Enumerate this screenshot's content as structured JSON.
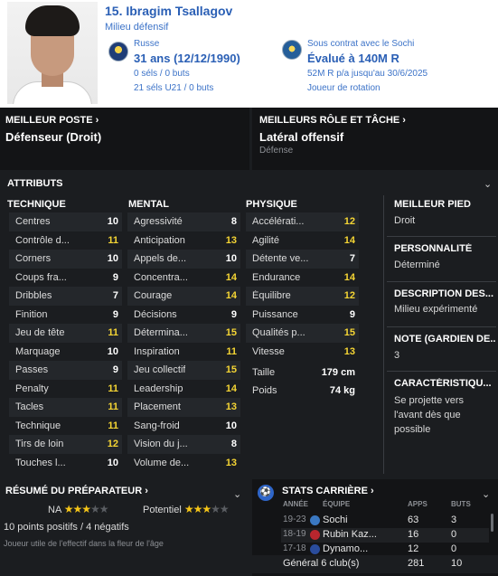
{
  "header": {
    "name": "15. Ibragim Tsallagov",
    "position": "Milieu défensif",
    "nationality": "Russe",
    "age": "31 ans (12/12/1990)",
    "caps": "0 séls / 0 buts",
    "u21_caps": "21 séls U21 / 0 buts",
    "contract": "Sous contrat avec le Sochi",
    "valuation": "Évalué à 140M R",
    "wage": "52M R p/a jusqu'au 30/6/2025",
    "squad_status": "Joueur de rotation"
  },
  "best_position": {
    "title": "MEILLEUR POSTE",
    "value": "Défenseur (Droit)"
  },
  "best_role": {
    "title": "MEILLEURS RÔLE ET TÂCHE",
    "value": "Latéral offensif",
    "duty": "Défense"
  },
  "attributes": {
    "title": "ATTRIBUTS",
    "technical": {
      "title": "TECHNIQUE",
      "rows": [
        {
          "label": "Centres",
          "value": "10"
        },
        {
          "label": "Contrôle d...",
          "value": "11"
        },
        {
          "label": "Corners",
          "value": "10"
        },
        {
          "label": "Coups fra...",
          "value": "9"
        },
        {
          "label": "Dribbles",
          "value": "7"
        },
        {
          "label": "Finition",
          "value": "9"
        },
        {
          "label": "Jeu de tête",
          "value": "11"
        },
        {
          "label": "Marquage",
          "value": "10"
        },
        {
          "label": "Passes",
          "value": "9"
        },
        {
          "label": "Penalty",
          "value": "11"
        },
        {
          "label": "Tacles",
          "value": "11"
        },
        {
          "label": "Technique",
          "value": "11"
        },
        {
          "label": "Tirs de loin",
          "value": "12"
        },
        {
          "label": "Touches l...",
          "value": "10"
        }
      ]
    },
    "mental": {
      "title": "MENTAL",
      "rows": [
        {
          "label": "Agressivité",
          "value": "8"
        },
        {
          "label": "Anticipation",
          "value": "13"
        },
        {
          "label": "Appels de...",
          "value": "10"
        },
        {
          "label": "Concentra...",
          "value": "14"
        },
        {
          "label": "Courage",
          "value": "14"
        },
        {
          "label": "Décisions",
          "value": "9"
        },
        {
          "label": "Détermina...",
          "value": "15"
        },
        {
          "label": "Inspiration",
          "value": "11"
        },
        {
          "label": "Jeu collectif",
          "value": "15"
        },
        {
          "label": "Leadership",
          "value": "14"
        },
        {
          "label": "Placement",
          "value": "13"
        },
        {
          "label": "Sang-froid",
          "value": "10"
        },
        {
          "label": "Vision du j...",
          "value": "8"
        },
        {
          "label": "Volume de...",
          "value": "13"
        }
      ]
    },
    "physical": {
      "title": "PHYSIQUE",
      "rows": [
        {
          "label": "Accélérati...",
          "value": "12"
        },
        {
          "label": "Agilité",
          "value": "14"
        },
        {
          "label": "Détente ve...",
          "value": "7"
        },
        {
          "label": "Endurance",
          "value": "14"
        },
        {
          "label": "Équilibre",
          "value": "12"
        },
        {
          "label": "Puissance",
          "value": "9"
        },
        {
          "label": "Qualités p...",
          "value": "15"
        },
        {
          "label": "Vitesse",
          "value": "13"
        }
      ],
      "height_label": "Taille",
      "height_value": "179 cm",
      "weight_label": "Poids",
      "weight_value": "74 kg"
    }
  },
  "info": {
    "foot_title": "MEILLEUR PIED",
    "foot_value": "Droit",
    "personality_title": "PERSONNALITÉ",
    "personality_value": "Déterminé",
    "description_title": "DESCRIPTION DES...",
    "description_value": "Milieu expérimenté",
    "gk_title": "NOTE (GARDIEN DE...",
    "gk_value": "3",
    "traits_title": "CARACTÉRISTIQU...",
    "traits_value": "Se projette vers l'avant dès que possible"
  },
  "coach_report": {
    "title": "RÉSUMÉ DU PRÉPARATEUR",
    "current_label": "NA",
    "current_stars": 3,
    "potential_label": "Potentiel",
    "potential_stars": 3,
    "summary": "10 points positifs / 4 négatifs",
    "comment": "Joueur utile de l'effectif dans la fleur de l'âge"
  },
  "career": {
    "title": "STATS CARRIÈRE",
    "headers": {
      "year": "ANNÉE",
      "team": "ÉQUIPE",
      "apps": "APPS",
      "goals": "BUTS"
    },
    "rows": [
      {
        "year": "19-23",
        "team": "Sochi",
        "apps": "63",
        "goals": "3"
      },
      {
        "year": "18-19",
        "team": "Rubin Kaz...",
        "apps": "16",
        "goals": "0"
      },
      {
        "year": "17-18",
        "team": "Dynamo...",
        "apps": "12",
        "goals": "0"
      }
    ],
    "total_label": "Général 6 club(s)",
    "total_apps": "281",
    "total_goals": "10"
  },
  "colors": {
    "accent": "#2a5fb5",
    "highlight": "#f5d534",
    "panel": "#1b1d20"
  }
}
